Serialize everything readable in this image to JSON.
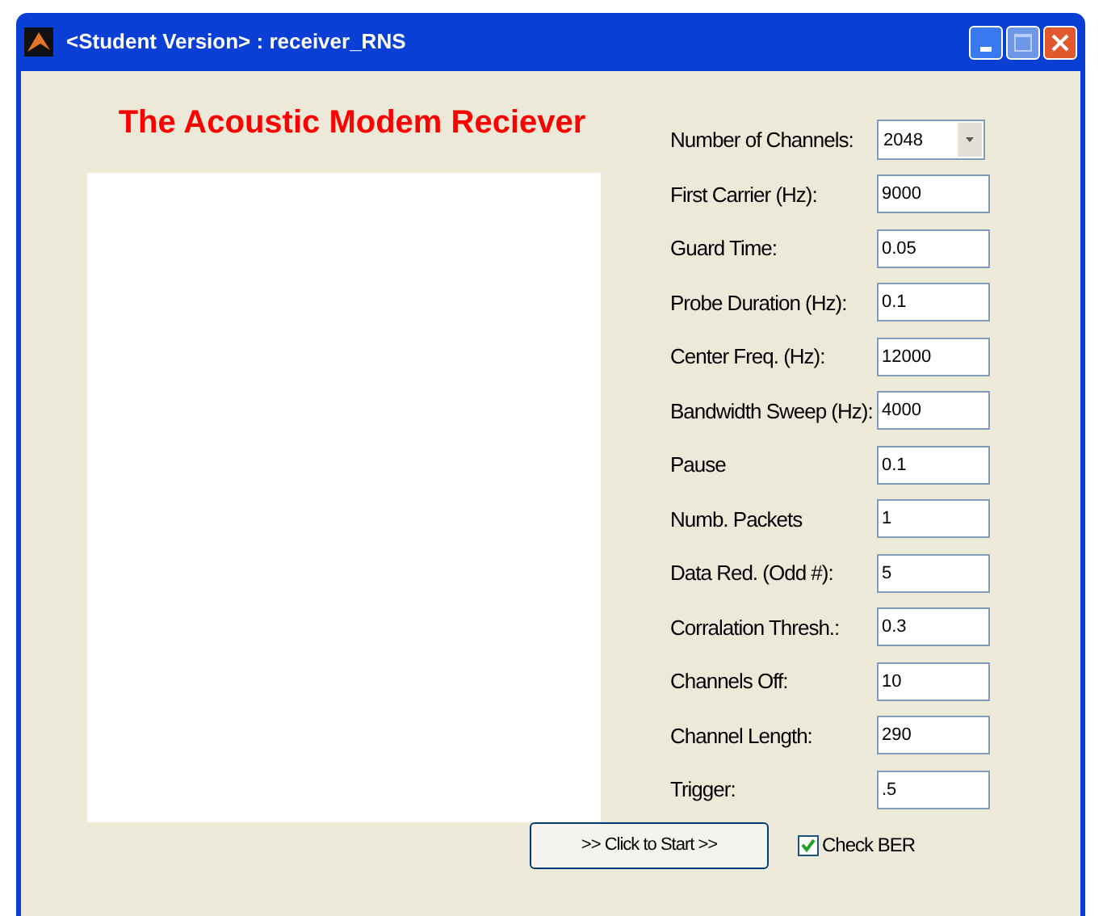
{
  "window": {
    "title": "<Student Version> : receiver_RNS"
  },
  "heading": "The Acoustic Modem Reciever",
  "params": [
    {
      "kind": "dropdown",
      "label": "Number of Channels:",
      "value": "2048"
    },
    {
      "kind": "field",
      "label": "First Carrier (Hz):",
      "value": "9000"
    },
    {
      "kind": "field",
      "label": "Guard Time:",
      "value": "0.05"
    },
    {
      "kind": "field",
      "label": "Probe Duration (Hz):",
      "value": "0.1"
    },
    {
      "kind": "field",
      "label": "Center Freq. (Hz):",
      "value": "12000"
    },
    {
      "kind": "field",
      "label": "Bandwidth Sweep (Hz):",
      "value": "4000"
    },
    {
      "kind": "field",
      "label": "Pause",
      "value": "0.1"
    },
    {
      "kind": "field",
      "label": "Numb. Packets",
      "value": "1"
    },
    {
      "kind": "field",
      "label": "Data Red. (Odd #):",
      "value": "5"
    },
    {
      "kind": "field",
      "label": "Corralation Thresh.:",
      "value": "0.3"
    },
    {
      "kind": "field",
      "label": "Channels Off:",
      "value": "10"
    },
    {
      "kind": "field",
      "label": "Channel Length:",
      "value": "290"
    },
    {
      "kind": "field",
      "label": "Trigger:",
      "value": ".5"
    }
  ],
  "start_button": ">> Click to Start >>",
  "check_ber": {
    "label": "Check BER",
    "checked": true
  }
}
